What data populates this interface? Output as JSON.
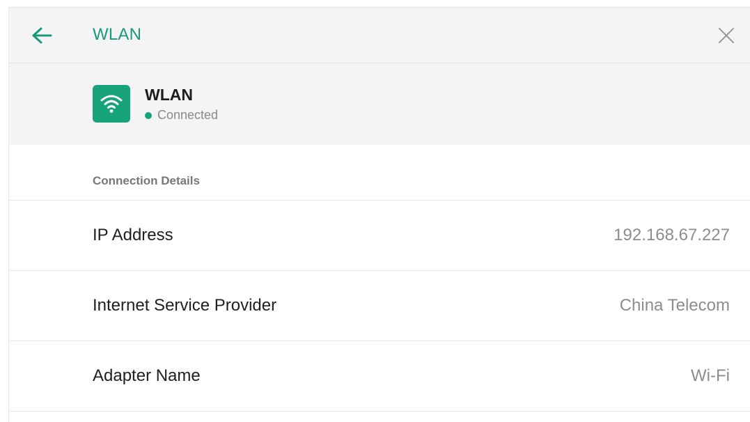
{
  "titlebar": {
    "back_icon": "arrow-left-icon",
    "title": "WLAN",
    "close_icon": "close-icon",
    "accent_color": "#179a76"
  },
  "network": {
    "icon": "wifi-icon",
    "name": "WLAN",
    "status": "Connected",
    "status_color": "#16a37a"
  },
  "details": {
    "section_title": "Connection Details",
    "rows": [
      {
        "label": "IP Address",
        "value": "192.168.67.227"
      },
      {
        "label": "Internet Service Provider",
        "value": "China Telecom"
      },
      {
        "label": "Adapter Name",
        "value": "Wi-Fi"
      }
    ]
  }
}
